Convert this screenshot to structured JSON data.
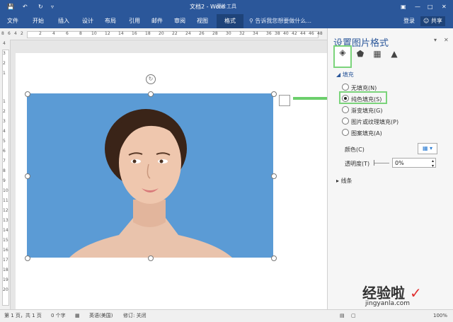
{
  "titlebar": {
    "doc_title": "文档2 - Word",
    "context_tab_label": "图片工具",
    "save_icon": "save-icon",
    "undo_icon": "undo-icon",
    "redo_icon": "redo-icon"
  },
  "tabs": [
    "文件",
    "开始",
    "插入",
    "设计",
    "布局",
    "引用",
    "邮件",
    "审阅",
    "视图",
    "格式"
  ],
  "tellme": "告诉我您想要做什么...",
  "account": {
    "login": "登录",
    "share": "共享"
  },
  "hruler": [
    "8",
    "6",
    "4",
    "2",
    "2",
    "4",
    "6",
    "8",
    "10",
    "12",
    "14",
    "16",
    "18",
    "20",
    "22",
    "24",
    "26",
    "28",
    "30",
    "32",
    "34",
    "36",
    "38",
    "40",
    "42",
    "44",
    "46",
    "48"
  ],
  "vruler": [
    "4",
    "3",
    "2",
    "1",
    "1",
    "2",
    "3",
    "4",
    "5",
    "6",
    "7",
    "8",
    "9",
    "10",
    "11",
    "12",
    "13",
    "14",
    "15",
    "16",
    "17",
    "18",
    "19",
    "20"
  ],
  "pane": {
    "title": "设置图片格式",
    "fill_section": "填充",
    "fill_options": [
      {
        "label": "无填充(N)",
        "selected": false
      },
      {
        "label": "纯色填充(S)",
        "selected": true
      },
      {
        "label": "渐变填充(G)",
        "selected": false
      },
      {
        "label": "图片或纹理填充(P)",
        "selected": false
      },
      {
        "label": "图案填充(A)",
        "selected": false
      }
    ],
    "color_label": "颜色(C)",
    "transparency_label": "透明度(T)",
    "transparency_value": "0%",
    "line_section": "线条"
  },
  "status": {
    "page": "第 1 页，共 1 页",
    "words": "0 个字",
    "language": "英语(美国)",
    "track": "修订: 关闭",
    "zoom": "100%"
  },
  "watermark": {
    "brand": "经验啦",
    "url": "jingyanla.com"
  },
  "colors": {
    "accent": "#2b579a",
    "picture_bg": "#5b9bd5",
    "highlight": "#7bd47b"
  }
}
